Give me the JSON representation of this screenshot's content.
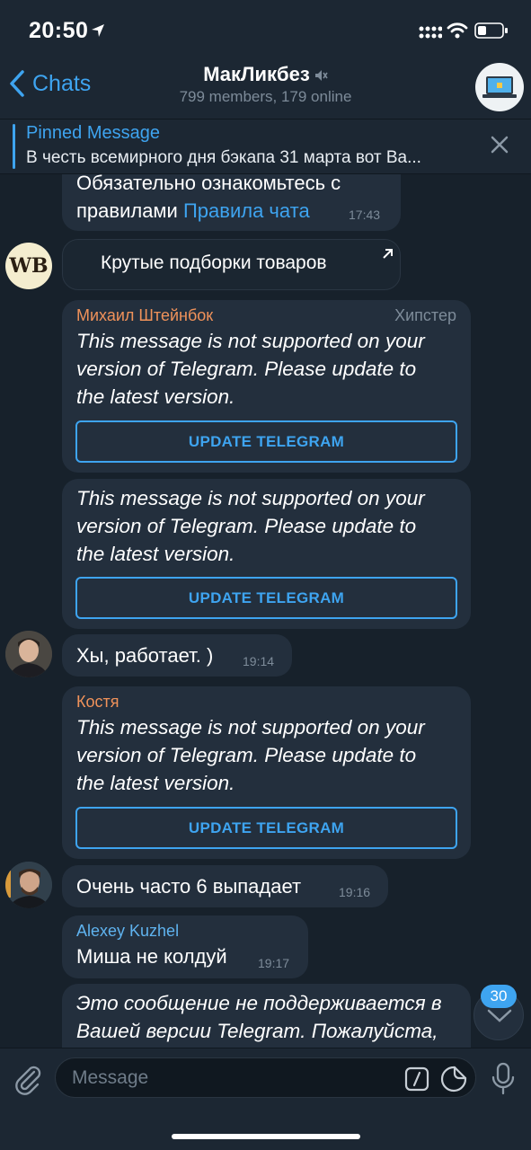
{
  "status": {
    "time": "20:50"
  },
  "nav": {
    "back_label": "Chats",
    "title": "МакЛикбез",
    "subtitle": "799 members, 179 online"
  },
  "pinned": {
    "title": "Pinned Message",
    "text": "В честь всемирного дня бэкапа 31 марта вот Ва..."
  },
  "messages": {
    "m1": {
      "line1": "Обязательно ознакомьтесь с",
      "line2": "правилами ",
      "link": "Правила чата",
      "time": "17:43"
    },
    "m2": {
      "avatar": "WB",
      "text": "Крутые подборки товаров"
    },
    "m3": {
      "sender": "Михаил Штейнбок",
      "title_badge": "Хипстер",
      "l1": "This message is not supported on your",
      "l2": "version of Telegram. Please update to",
      "l3": "the latest version.",
      "button": "UPDATE TELEGRAM"
    },
    "m4": {
      "l1": "This message is not supported on your",
      "l2": "version of Telegram. Please update to",
      "l3": "the latest version.",
      "button": "UPDATE TELEGRAM"
    },
    "m5": {
      "text": "Хы, работает. )",
      "time": "19:14"
    },
    "m6": {
      "sender": "Костя",
      "l1": "This message is not supported on your",
      "l2": "version of Telegram. Please update to",
      "l3": "the latest version.",
      "button": "UPDATE TELEGRAM"
    },
    "m7": {
      "text": "Очень часто 6 выпадает",
      "time": "19:16"
    },
    "m8": {
      "sender": "Alexey Kuzhel",
      "text": "Миша не колдуй",
      "time": "19:17"
    },
    "m9": {
      "l1": "Это сообщение не поддерживается в",
      "l2": "Вашей версии Telegram. Пожалуйста,"
    }
  },
  "unread_badge": "30",
  "input": {
    "placeholder": "Message"
  },
  "colors": {
    "accent": "#3ea4f0",
    "bubble": "#232f3d",
    "background": "#17212b",
    "sender_orange": "#f0925a",
    "sender_blue": "#5fb3ef"
  }
}
